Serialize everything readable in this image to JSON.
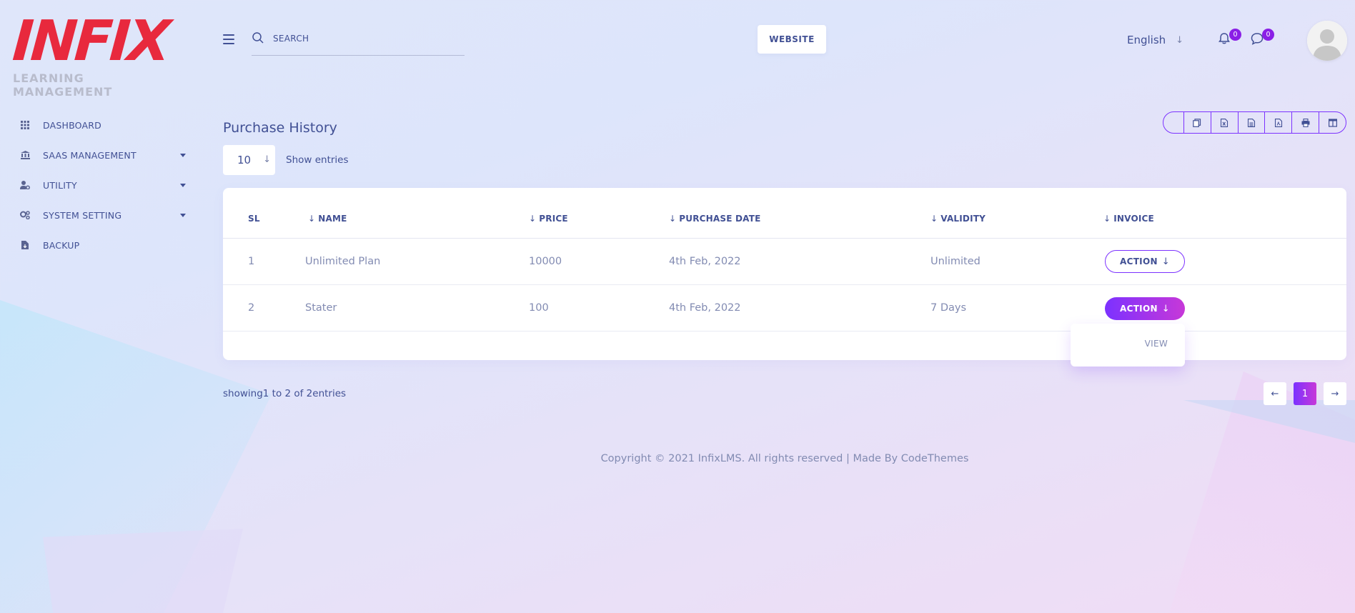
{
  "brand": {
    "logo_text": "INFIX",
    "logo_subtitle": "LEARNING MANAGEMENT",
    "accent": "#7c32ff",
    "accent_end": "#c738d8",
    "logo_color": "#e8293d"
  },
  "sidebar": {
    "items": [
      {
        "label": "DASHBOARD",
        "icon": "grid-icon",
        "has_submenu": false
      },
      {
        "label": "SAAS MANAGEMENT",
        "icon": "bank-icon",
        "has_submenu": true
      },
      {
        "label": "UTILITY",
        "icon": "user-gear-icon",
        "has_submenu": true
      },
      {
        "label": "SYSTEM SETTING",
        "icon": "gears-icon",
        "has_submenu": true
      },
      {
        "label": "BACKUP",
        "icon": "file-download-icon",
        "has_submenu": false
      }
    ]
  },
  "header": {
    "search_placeholder": "SEARCH",
    "website_label": "WEBSITE",
    "language": "English",
    "notifications_count": "0",
    "messages_count": "0"
  },
  "main": {
    "title": "Purchase History",
    "entries_value": "10",
    "entries_label": "Show entries",
    "export_buttons": [
      "copy-icon",
      "excel-icon",
      "csv-icon",
      "pdf-icon",
      "print-icon",
      "columns-icon"
    ],
    "table": {
      "columns": [
        "SL",
        "NAME",
        "PRICE",
        "PURCHASE DATE",
        "VALIDITY",
        "INVOICE"
      ],
      "rows": [
        {
          "sl": "1",
          "name": "Unlimited Plan",
          "price": "10000",
          "purchase_date": "4th Feb, 2022",
          "validity": "Unlimited",
          "action": "ACTION"
        },
        {
          "sl": "2",
          "name": "Stater",
          "price": "100",
          "purchase_date": "4th Feb, 2022",
          "validity": "7 Days",
          "action": "ACTION"
        }
      ],
      "dropdown_item": "VIEW"
    },
    "showing_text": "showing1 to 2 of 2entries",
    "pagination": {
      "current": "1"
    }
  },
  "footer": {
    "copyright": "Copyright © 2021 InfixLMS. All rights reserved | Made By CodeThemes"
  }
}
